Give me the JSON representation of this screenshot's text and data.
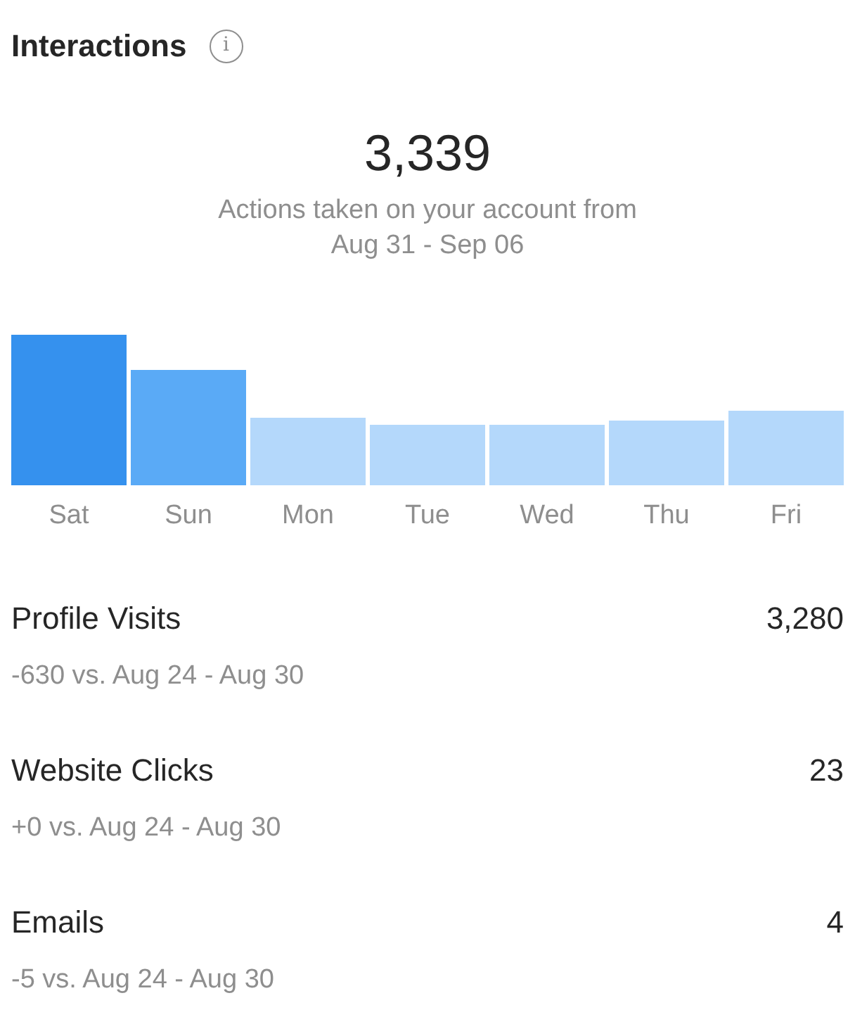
{
  "header": {
    "title": "Interactions",
    "info_icon": "i"
  },
  "summary": {
    "total": "3,339",
    "caption": "Actions taken on your account from",
    "range": "Aug 31 - Sep 06"
  },
  "days": [
    {
      "label": "Sat",
      "color": "#3591ee"
    },
    {
      "label": "Sun",
      "color": "#5aaaf6"
    },
    {
      "label": "Mon",
      "color": "#b4d8fb"
    },
    {
      "label": "Tue",
      "color": "#b4d8fb"
    },
    {
      "label": "Wed",
      "color": "#b4d8fb"
    },
    {
      "label": "Thu",
      "color": "#b4d8fb"
    },
    {
      "label": "Fri",
      "color": "#b4d8fb"
    }
  ],
  "metrics": [
    {
      "label": "Profile Visits",
      "value": "3,280",
      "change": "-630 vs. Aug 24 - Aug 30"
    },
    {
      "label": "Website Clicks",
      "value": "23",
      "change": "+0 vs. Aug 24 - Aug 30"
    },
    {
      "label": "Emails",
      "value": "4",
      "change": "-5 vs. Aug 24 - Aug 30"
    }
  ]
}
